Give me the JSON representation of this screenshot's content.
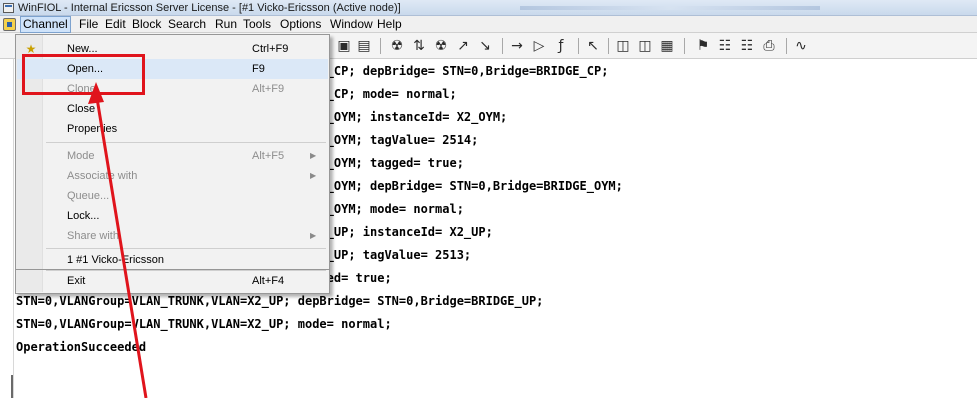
{
  "window": {
    "title": "WinFIOL - Internal Ericsson Server License - [#1 Vicko-Ericsson (Active node)]"
  },
  "menubar": {
    "items": [
      "Channel",
      "File",
      "Edit",
      "Block",
      "Search",
      "Run",
      "Tools",
      "Options",
      "Window",
      "Help"
    ]
  },
  "toolbar": {
    "icons": [
      "new-channel-icon",
      "save-icon",
      "print-icon",
      "find-icon",
      "find-in-files-icon",
      "find-next-icon",
      "search-up-icon",
      "search-down-icon",
      "goto-icon",
      "run-icon",
      "fn-icon",
      "help-pointer-icon",
      "split-icon",
      "split-alt-icon",
      "properties-icon",
      "flag-icon",
      "compare-icon",
      "grid-icon",
      "printer-icon",
      "more-icon"
    ]
  },
  "dropdown": {
    "items": [
      {
        "label": "New...",
        "shortcut": "Ctrl+F9",
        "disabled": false,
        "submenu": false
      },
      {
        "label": "Open...",
        "shortcut": "F9",
        "disabled": false,
        "submenu": false
      },
      {
        "label": "Clone",
        "shortcut": "Alt+F9",
        "disabled": true,
        "submenu": false
      },
      {
        "label": "Close",
        "shortcut": "",
        "disabled": false,
        "submenu": false
      },
      {
        "label": "Properties",
        "shortcut": "",
        "disabled": false,
        "submenu": false
      },
      {
        "label": "Mode",
        "shortcut": "Alt+F5",
        "disabled": true,
        "submenu": true
      },
      {
        "label": "Associate with",
        "shortcut": "",
        "disabled": true,
        "submenu": true
      },
      {
        "label": "Queue...",
        "shortcut": "",
        "disabled": true,
        "submenu": false
      },
      {
        "label": "Lock...",
        "shortcut": "",
        "disabled": false,
        "submenu": false
      },
      {
        "label": "Share with",
        "shortcut": "",
        "disabled": true,
        "submenu": true
      },
      {
        "label": "1 #1 Vicko-Ericsson",
        "shortcut": "",
        "disabled": false,
        "submenu": false
      },
      {
        "label": "Exit",
        "shortcut": "Alt+F4",
        "disabled": false,
        "submenu": false
      }
    ],
    "highlighted": "Open..."
  },
  "editor": {
    "lines": [
      "S                                      N=X2_CP; depBridge= STN=0,Bridge=BRIDGE_CP;",
      "S                                      N=X2_CP; mode= normal;",
      "S                                      N=X2_OYM; instanceId= X2_OYM;",
      "S                                      N=X2_OYM; tagValue= 2514;",
      "S                                      N=X2_OYM; tagged= true;",
      "S                                      N=X2_OYM; depBridge= STN=0,Bridge=BRIDGE_OYM;",
      "S                                      N=X2_OYM; mode= normal;",
      "S                                      N=X2_UP; instanceId= X2_UP;",
      "S                                      N=X2_UP; tagValue= 2513;",
      "STN=0,VLANGroup=VLAN_TRUNK,VLAN=X2_UP; tagged= true;",
      "STN=0,VLANGroup=VLAN_TRUNK,VLAN=X2_UP; depBridge= STN=0,Bridge=BRIDGE_UP;",
      "STN=0,VLANGroup=VLAN_TRUNK,VLAN=X2_UP; mode= normal;",
      "OperationSucceeded"
    ]
  },
  "annotation": {
    "highlight_color": "#e0141c"
  }
}
